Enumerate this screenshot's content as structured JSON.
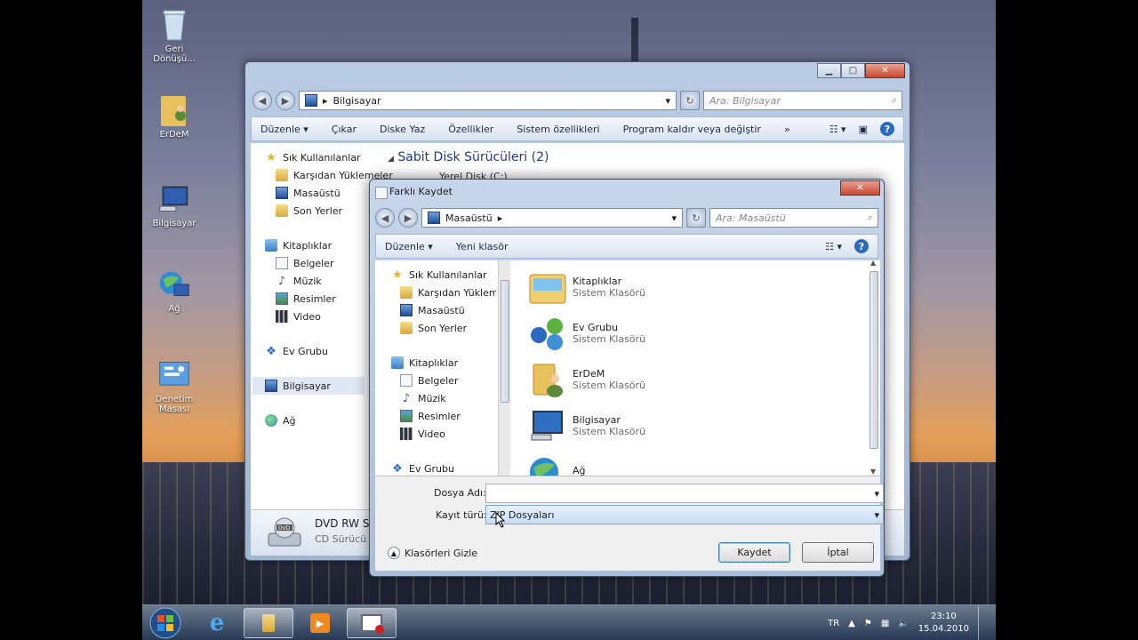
{
  "desktop": {
    "icons": [
      {
        "label": "Geri Dönüşü..."
      },
      {
        "label": "ErDeM"
      },
      {
        "label": "Bilgisayar"
      },
      {
        "label": "Ağ"
      },
      {
        "label": "Denetim Masası"
      }
    ]
  },
  "explorer": {
    "address": "Bilgisayar",
    "search_placeholder": "Ara: Bilgisayar",
    "toolbar": [
      "Düzenle ▾",
      "Çıkar",
      "Diske Yaz",
      "Özellikler",
      "Sistem özellikleri",
      "Program kaldır veya değiştir",
      "»"
    ],
    "nav": [
      {
        "label": "Sık Kullanılanlar",
        "icon": "star-icon",
        "level": 0
      },
      {
        "label": "Karşıdan Yüklemeler",
        "icon": "folder-icon",
        "level": 1
      },
      {
        "label": "Masaüstü",
        "icon": "monitor-icon",
        "level": 1
      },
      {
        "label": "Son Yerler",
        "icon": "folder-icon",
        "level": 1
      },
      {
        "label": "Kitaplıklar",
        "icon": "library-icon",
        "level": 0
      },
      {
        "label": "Belgeler",
        "icon": "document-icon",
        "level": 1
      },
      {
        "label": "Müzik",
        "icon": "music-icon",
        "level": 1
      },
      {
        "label": "Resimler",
        "icon": "picture-icon",
        "level": 1
      },
      {
        "label": "Video",
        "icon": "video-icon",
        "level": 1
      },
      {
        "label": "Ev Grubu",
        "icon": "homegroup-icon",
        "level": 0
      },
      {
        "label": "Bilgisayar",
        "icon": "computer-icon",
        "level": 0
      },
      {
        "label": "Ağ",
        "icon": "network-icon",
        "level": 0
      }
    ],
    "section_header": "Sabit Disk Sürücüleri (2)",
    "drive_partial": "Yerel Disk (C:)",
    "bottom_item": {
      "name": "DVD RW S",
      "type": "CD Sürücü"
    }
  },
  "dialog": {
    "title": "Farklı Kaydet",
    "address": "Masaüstü",
    "search_placeholder": "Ara: Masaüstü",
    "toolbar": {
      "organize": "Düzenle ▾",
      "new_folder": "Yeni klasör"
    },
    "nav": [
      {
        "label": "Sık Kullanılanlar",
        "icon": "star-icon",
        "level": 0
      },
      {
        "label": "Karşıdan Yüklem",
        "icon": "folder-icon",
        "level": 1
      },
      {
        "label": "Masaüstü",
        "icon": "monitor-icon",
        "level": 1
      },
      {
        "label": "Son Yerler",
        "icon": "folder-icon",
        "level": 1
      },
      {
        "label": "Kitaplıklar",
        "icon": "library-icon",
        "level": 0
      },
      {
        "label": "Belgeler",
        "icon": "document-icon",
        "level": 1
      },
      {
        "label": "Müzik",
        "icon": "music-icon",
        "level": 1
      },
      {
        "label": "Resimler",
        "icon": "picture-icon",
        "level": 1
      },
      {
        "label": "Video",
        "icon": "video-icon",
        "level": 1
      },
      {
        "label": "Ev Grubu",
        "icon": "homegroup-icon",
        "level": 0
      }
    ],
    "files": [
      {
        "name": "Kitaplıklar",
        "type": "Sistem Klasörü",
        "icon": "library-folder-icon"
      },
      {
        "name": "Ev Grubu",
        "type": "Sistem Klasörü",
        "icon": "homegroup-icon"
      },
      {
        "name": "ErDeM",
        "type": "Sistem Klasörü",
        "icon": "user-folder-icon"
      },
      {
        "name": "Bilgisayar",
        "type": "Sistem Klasörü",
        "icon": "computer-icon"
      },
      {
        "name": "Ağ",
        "type": "",
        "icon": "network-icon"
      }
    ],
    "filename_label": "Dosya Adı:",
    "filename_value": "",
    "filetype_label": "Kayıt türü:",
    "filetype_value": "ZIP Dosyaları",
    "hide_folders": "Klasörleri Gizle",
    "save_button": "Kaydet",
    "cancel_button": "İptal"
  },
  "taskbar": {
    "language": "TR",
    "time": "23:10",
    "date": "15.04.2010"
  }
}
